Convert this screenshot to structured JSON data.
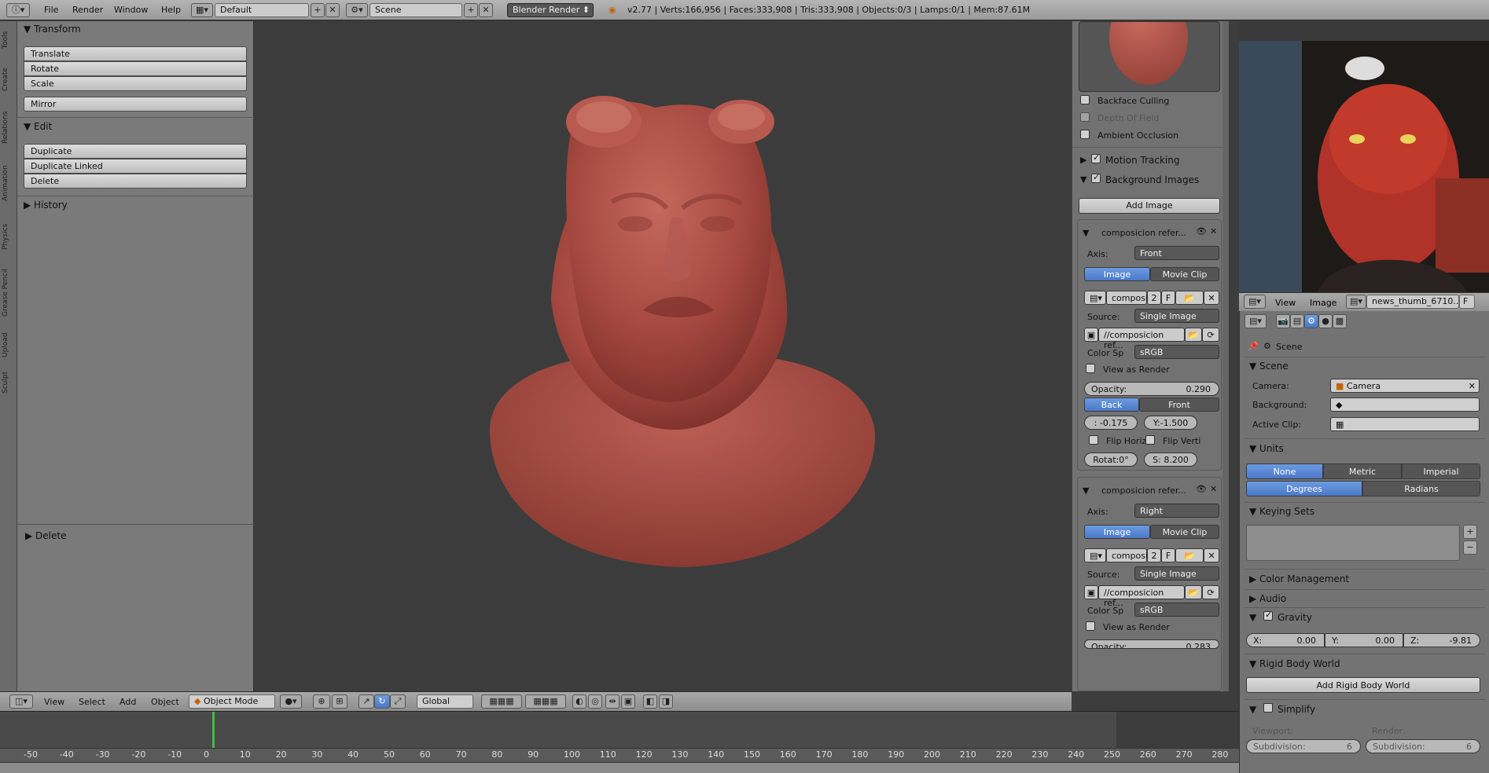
{
  "topbar": {
    "menu": [
      "File",
      "Render",
      "Window",
      "Help"
    ],
    "layout": "Default",
    "scene": "Scene",
    "engine": "Blender Render",
    "stats": "v2.77 | Verts:166,956 | Faces:333,908 | Tris:333,908 | Objects:0/3 | Lamps:0/1 | Mem:87.61M"
  },
  "tooltabs": [
    "Tools",
    "Create",
    "Relations",
    "Animation",
    "Physics",
    "Grease Pencil",
    "Upload",
    "Sculpt"
  ],
  "toolshelf": {
    "transform_header": "Transform",
    "transform": [
      "Translate",
      "Rotate",
      "Scale"
    ],
    "mirror": "Mirror",
    "edit_header": "Edit",
    "edit": [
      "Duplicate",
      "Duplicate Linked",
      "Delete"
    ],
    "history_header": "History",
    "operator_header": "Delete"
  },
  "viewport_header": {
    "menu": [
      "View",
      "Select",
      "Add",
      "Object"
    ],
    "mode": "Object Mode",
    "orientation": "Global"
  },
  "timeline": {
    "ticks": [
      "-50",
      "-40",
      "-30",
      "-20",
      "-10",
      "0",
      "10",
      "20",
      "30",
      "40",
      "50",
      "60",
      "70",
      "80",
      "90",
      "100",
      "110",
      "120",
      "130",
      "140",
      "150",
      "160",
      "170",
      "180",
      "190",
      "200",
      "210",
      "220",
      "230",
      "240",
      "250",
      "260",
      "270",
      "280"
    ],
    "current_frame_color": "#3fc03f"
  },
  "npanel": {
    "backface": "Backface Culling",
    "dof": "Depth Of Field",
    "ao": "Ambient Occlusion",
    "motion_tracking": "Motion Tracking",
    "background_images": "Background Images",
    "add_image": "Add Image",
    "images": [
      {
        "name": "composicion refer...",
        "axis_label": "Axis:",
        "axis": "Front",
        "tab_image": "Image",
        "tab_clip": "Movie Clip",
        "img_name": "composi",
        "users": "2",
        "fake": "F",
        "source_label": "Source:",
        "source": "Single Image",
        "path": "//composicion ref...",
        "colorsp_label": "Color Sp",
        "colorsp": "sRGB",
        "view_as_render": "View as Render",
        "opacity_label": "Opacity:",
        "opacity": "0.290",
        "back": "Back",
        "front": "Front",
        "x": ": -0.175",
        "y": "Y:-1.500",
        "flip_h": "Flip Horiz",
        "flip_v": "Flip Verti",
        "rot": "Rotat:0°",
        "size": "S: 8.200"
      },
      {
        "name": "composicion refer...",
        "axis_label": "Axis:",
        "axis": "Right",
        "tab_image": "Image",
        "tab_clip": "Movie Clip",
        "img_name": "composi",
        "users": "2",
        "fake": "F",
        "source_label": "Source:",
        "source": "Single Image",
        "path": "//composicion ref...",
        "colorsp_label": "Color Sp",
        "colorsp": "sRGB",
        "view_as_render": "View as Render",
        "opacity_label": "Opacity:",
        "opacity": "0.283"
      }
    ]
  },
  "image_editor": {
    "menu": [
      "View",
      "Image"
    ],
    "image_name": "news_thumb_6710...",
    "fake": "F"
  },
  "properties": {
    "context": "Scene",
    "scene_header": "Scene",
    "camera_label": "Camera:",
    "camera": "Camera",
    "background_label": "Background:",
    "active_clip_label": "Active Clip:",
    "units_header": "Units",
    "unit_systems": [
      "None",
      "Metric",
      "Imperial"
    ],
    "rotation_units": [
      "Degrees",
      "Radians"
    ],
    "keying_header": "Keying Sets",
    "color_mgmt": "Color Management",
    "audio": "Audio",
    "gravity": "Gravity",
    "gx": "X:",
    "gx_val": "0.00",
    "gy": "Y:",
    "gy_val": "0.00",
    "gz": "Z:",
    "gz_val": "-9.81",
    "rigid_header": "Rigid Body World",
    "add_rigid": "Add Rigid Body World",
    "simplify": "Simplify",
    "viewport_label": "Viewport:",
    "render_label": "Render:",
    "subdiv_label": "Subdivision:",
    "subdiv_vp": "6",
    "subdiv_r": "6"
  }
}
